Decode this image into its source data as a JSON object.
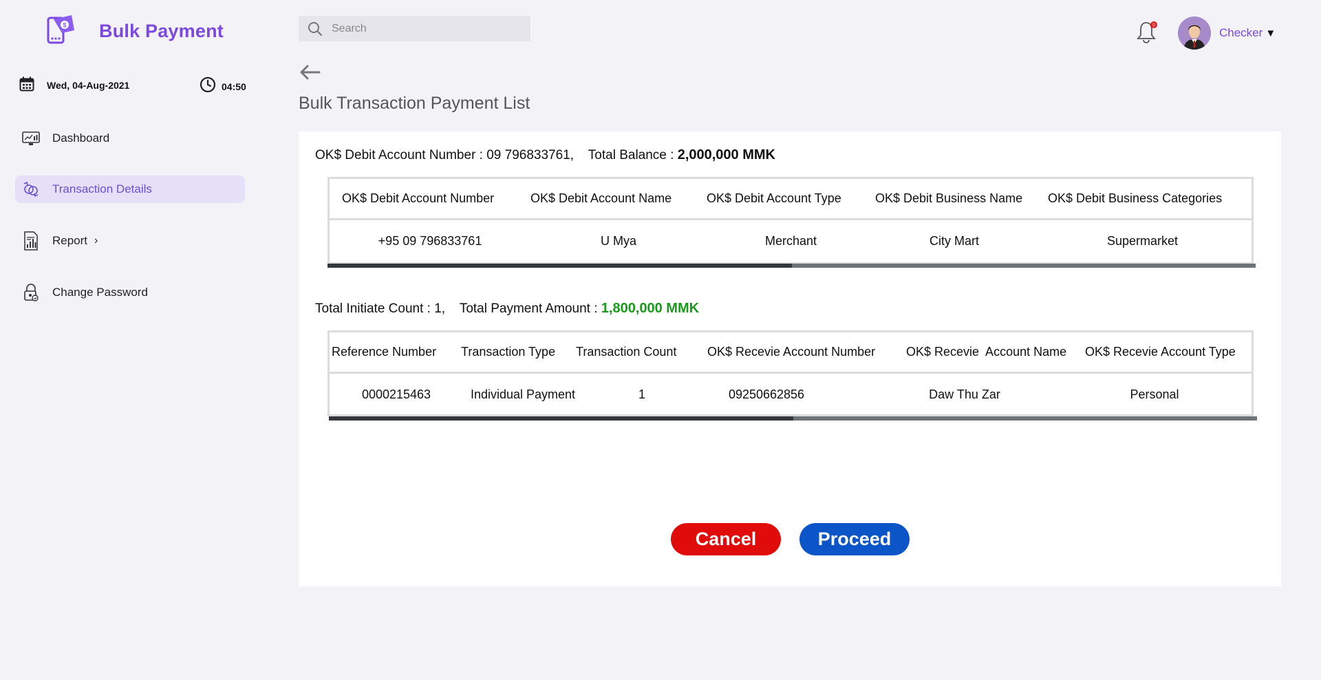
{
  "brand": {
    "title": "Bulk Payment"
  },
  "datetime": {
    "date": "Wed, 04-Aug-2021",
    "time": "04:50"
  },
  "sidebar": {
    "items": [
      {
        "label": "Dashboard",
        "icon": "dashboard-icon",
        "active": false
      },
      {
        "label": "Transaction Details",
        "icon": "transaction-icon",
        "active": true
      },
      {
        "label": "Report",
        "icon": "report-icon",
        "active": false,
        "chevron": "›"
      },
      {
        "label": "Change Password",
        "icon": "lock-icon",
        "active": false
      }
    ]
  },
  "header": {
    "search_placeholder": "Search",
    "notification_count": "0",
    "user_name": "Checker",
    "user_caret": "▼"
  },
  "page": {
    "title": "Bulk Transaction Payment List"
  },
  "debit_summary": {
    "prefix": "OK$ Debit Account Number : 09 796833761,    Total Balance : ",
    "balance": "2,000,000 MMK"
  },
  "debit_table": {
    "headers": [
      "OK$ Debit Account Number",
      "OK$ Debit Account Name",
      "OK$ Debit Account Type",
      "OK$ Debit Business Name",
      "OK$ Debit Business Categories"
    ],
    "rows": [
      [
        "+95 09 796833761",
        "U Mya",
        "Merchant",
        "City Mart",
        "Supermarket"
      ]
    ],
    "scroll_fraction": 0.5
  },
  "payment_summary": {
    "prefix": "Total Initiate Count : 1,    Total Payment Amount : ",
    "amount": "1,800,000 MMK"
  },
  "payment_table": {
    "headers": [
      "Reference Number",
      "Transaction Type",
      "Transaction Count",
      "OK$ Recevie Account Number",
      "OK$ Recevie  Account Name",
      "OK$ Recevie Account Type"
    ],
    "rows": [
      [
        "0000215463",
        "Individual Payment",
        "1",
        "09250662856",
        "Daw Thu Zar",
        "Personal"
      ]
    ],
    "scroll_fraction": 0.5
  },
  "buttons": {
    "cancel": "Cancel",
    "proceed": "Proceed"
  },
  "colors": {
    "accent": "#7b49e0",
    "cancel": "#e00b0b",
    "proceed": "#0b55c9",
    "amount": "#1a9a1a"
  }
}
